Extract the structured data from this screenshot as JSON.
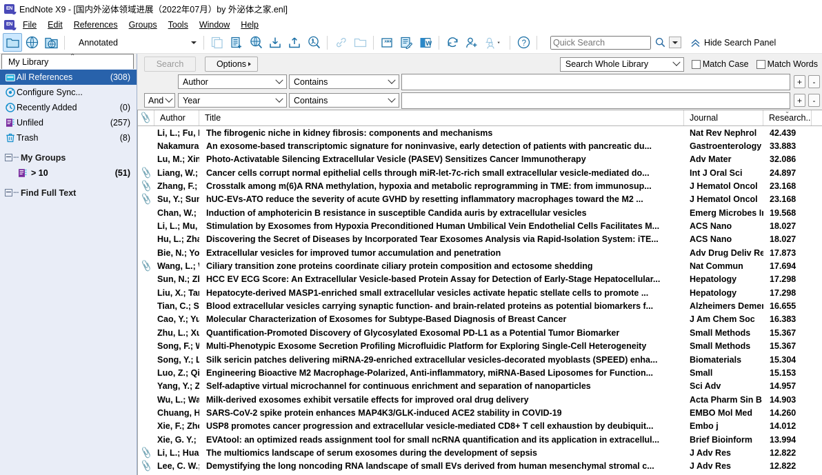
{
  "window": {
    "app_name": "EndNote X9",
    "title": "EndNote X9 - [国内外泌体领域进展（2022年07月）by 外泌体之家.enl]",
    "logo_text": "EN"
  },
  "menubar": {
    "items": [
      {
        "label": "File"
      },
      {
        "label": "Edit"
      },
      {
        "label": "References"
      },
      {
        "label": "Groups"
      },
      {
        "label": "Tools"
      },
      {
        "label": "Window"
      },
      {
        "label": "Help"
      }
    ]
  },
  "toolbar": {
    "style_selected": "Annotated",
    "quick_search_placeholder": "Quick Search",
    "quick_search_value": "",
    "hide_search_panel_label": "Hide Search Panel",
    "icons": [
      "local-library-icon",
      "online-search-icon",
      "integrated-library-icon",
      "copy-references-icon",
      "new-reference-icon",
      "online-search-mode-icon",
      "import-icon",
      "export-icon",
      "open-pdf-icon",
      "link-icon",
      "open-folder-icon",
      "insert-citation-icon",
      "format-bibliography-icon",
      "cwyw-word-icon",
      "sync-icon",
      "share-library-icon",
      "notify-icon",
      "help-icon"
    ]
  },
  "sidebar": {
    "library_tab": "My Library",
    "items": [
      {
        "label": "All References",
        "count": "(308)",
        "icon": "all-references-icon",
        "selected": true
      },
      {
        "label": "Configure Sync...",
        "count": "",
        "icon": "sync-config-icon",
        "selected": false
      },
      {
        "label": "Recently Added",
        "count": "(0)",
        "icon": "recently-added-icon",
        "selected": false
      },
      {
        "label": "Unfiled",
        "count": "(257)",
        "icon": "unfiled-icon",
        "selected": false
      },
      {
        "label": "Trash",
        "count": "(8)",
        "icon": "trash-icon",
        "selected": false
      }
    ],
    "groups": [
      {
        "header": "My Groups",
        "children": [
          {
            "label": "> 10",
            "count": "(51)",
            "icon": "group-icon"
          }
        ]
      },
      {
        "header": "Find Full Text",
        "children": []
      }
    ]
  },
  "search_panel": {
    "search_button": "Search",
    "options_button": "Options",
    "scope_selected": "Search Whole Library",
    "match_case_label": "Match Case",
    "match_words_label": "Match Words",
    "match_case_checked": false,
    "match_words_checked": false,
    "add_row_label": "+",
    "remove_row_label": "-",
    "rows": [
      {
        "operator": "",
        "field": "Author",
        "comparator": "Contains",
        "term": ""
      },
      {
        "operator": "And",
        "field": "Year",
        "comparator": "Contains",
        "term": ""
      }
    ]
  },
  "table": {
    "columns": [
      {
        "key": "clip",
        "label": ""
      },
      {
        "key": "author",
        "label": "Author"
      },
      {
        "key": "title",
        "label": "Title"
      },
      {
        "key": "journal",
        "label": "Journal"
      },
      {
        "key": "rating",
        "label": "Research...",
        "sorted": true,
        "sort_dir": "desc"
      }
    ],
    "rows": [
      {
        "clip": false,
        "author": "Li, L.; Fu, H.; Li...",
        "title": "The fibrogenic niche in kidney fibrosis: components and mechanisms",
        "journal": "Nat Rev Nephrol",
        "rating": "42.439"
      },
      {
        "clip": false,
        "author": "Nakamura, K.;...",
        "title": "An exosome-based transcriptomic signature for noninvasive, early detection of patients with pancreatic du...",
        "journal": "Gastroenterology",
        "rating": "33.883"
      },
      {
        "clip": false,
        "author": "Lu, M.; Xing, H...",
        "title": "Photo-Activatable Silencing Extracellular Vesicle (PASEV) Sensitizes Cancer Immunotherapy",
        "journal": "Adv Mater",
        "rating": "32.086"
      },
      {
        "clip": true,
        "author": "Liang, W.; Che...",
        "title": "Cancer cells corrupt normal epithelial cells through miR-let-7c-rich small extracellular vesicle-mediated do...",
        "journal": "Int J Oral Sci",
        "rating": "24.897"
      },
      {
        "clip": true,
        "author": "Zhang, F.; Liu, ...",
        "title": "Crosstalk among m(6)A RNA methylation, hypoxia and metabolic reprogramming in TME: from immunosup...",
        "journal": "J Hematol Oncol",
        "rating": "23.168"
      },
      {
        "clip": true,
        "author": "Su, Y.; Sun, X.; ...",
        "title": "hUC-EVs-ATO reduce the severity of acute GVHD by resetting inflammatory macrophages toward the M2 ...",
        "journal": "J Hematol Oncol",
        "rating": "23.168"
      },
      {
        "clip": false,
        "author": "Chan, W.; Cho...",
        "title": "Induction of amphotericin B resistance in susceptible Candida auris by extracellular vesicles",
        "journal": "Emerg Microbes Infect",
        "rating": "19.568"
      },
      {
        "clip": false,
        "author": "Li, L.; Mu, J.; Z...",
        "title": "Stimulation by Exosomes from Hypoxia Preconditioned Human Umbilical Vein Endothelial Cells Facilitates M...",
        "journal": "ACS Nano",
        "rating": "18.027"
      },
      {
        "clip": false,
        "author": "Hu, L.; Zhang, ...",
        "title": "Discovering the Secret of Diseases by Incorporated Tear Exosomes Analysis via Rapid-Isolation System: iTE...",
        "journal": "ACS Nano",
        "rating": "18.027"
      },
      {
        "clip": false,
        "author": "Bie, N.; Yong, ...",
        "title": "Extracellular vesicles for improved tumor accumulation and penetration",
        "journal": "Adv Drug Deliv Rev",
        "rating": "17.873"
      },
      {
        "clip": true,
        "author": "Wang, L.; Wen...",
        "title": "Ciliary transition zone proteins coordinate ciliary protein composition and ectosome shedding",
        "journal": "Nat Commun",
        "rating": "17.694"
      },
      {
        "clip": false,
        "author": "Sun, N.; Zhang...",
        "title": "HCC EV ECG Score: An Extracellular Vesicle-based Protein Assay for Detection of Early-Stage Hepatocellular...",
        "journal": "Hepatology",
        "rating": "17.298"
      },
      {
        "clip": false,
        "author": "Liu, X.; Tan, S.;...",
        "title": "Hepatocyte-derived MASP1-enriched small extracellular vesicles activate hepatic stellate cells to promote ...",
        "journal": "Hepatology",
        "rating": "17.298"
      },
      {
        "clip": false,
        "author": "Tian, C.; Stew...",
        "title": "Blood extracellular vesicles carrying synaptic function- and brain-related proteins as potential biomarkers f...",
        "journal": "Alzheimers Dement",
        "rating": "16.655"
      },
      {
        "clip": false,
        "author": "Cao, Y.; Yu, X.; ...",
        "title": "Molecular Characterization of Exosomes for Subtype-Based Diagnosis of Breast Cancer",
        "journal": "J Am Chem Soc",
        "rating": "16.383"
      },
      {
        "clip": false,
        "author": "Zhu, L.; Xu, Y.; ...",
        "title": "Quantification-Promoted Discovery of Glycosylated Exosomal PD-L1 as a Potential Tumor Biomarker",
        "journal": "Small Methods",
        "rating": "15.367"
      },
      {
        "clip": false,
        "author": "Song, F.; Wan...",
        "title": "Multi-Phenotypic Exosome Secretion Profiling Microfluidic Platform for Exploring Single-Cell Heterogeneity",
        "journal": "Small Methods",
        "rating": "15.367"
      },
      {
        "clip": false,
        "author": "Song, Y.; Li, M....",
        "title": "Silk sericin patches delivering miRNA-29-enriched extracellular vesicles-decorated myoblasts (SPEED) enha...",
        "journal": "Biomaterials",
        "rating": "15.304"
      },
      {
        "clip": false,
        "author": "Luo, Z.; Qi, B.; ...",
        "title": "Engineering Bioactive M2 Macrophage-Polarized, Anti-inflammatory, miRNA-Based Liposomes for Function...",
        "journal": "Small",
        "rating": "15.153"
      },
      {
        "clip": false,
        "author": "Yang, Y.; Zhan...",
        "title": "Self-adaptive virtual microchannel for continuous enrichment and separation of nanoparticles",
        "journal": "Sci Adv",
        "rating": "14.957"
      },
      {
        "clip": false,
        "author": "Wu, L.; Wang, ...",
        "title": "Milk-derived exosomes exhibit versatile effects for improved oral drug delivery",
        "journal": "Acta Pharm Sin B",
        "rating": "14.903"
      },
      {
        "clip": false,
        "author": "Chuang, H. C.; ...",
        "title": "SARS-CoV-2 spike protein enhances MAP4K3/GLK-induced ACE2 stability in COVID-19",
        "journal": "EMBO Mol Med",
        "rating": "14.260"
      },
      {
        "clip": false,
        "author": "Xie, F.; Zhou, ...",
        "title": "USP8 promotes cancer progression and extracellular vesicle-mediated CD8+ T cell exhaustion by deubiquit...",
        "journal": "Embo j",
        "rating": "14.012"
      },
      {
        "clip": false,
        "author": "Xie, G. Y.; Liu, ...",
        "title": "EVAtool: an optimized reads assignment tool for small ncRNA quantification and its application in extracellul...",
        "journal": "Brief Bioinform",
        "rating": "13.994"
      },
      {
        "clip": true,
        "author": "Li, L.; Huang, L...",
        "title": "The multiomics landscape of serum exosomes during the development of sepsis",
        "journal": "J Adv Res",
        "rating": "12.822"
      },
      {
        "clip": true,
        "author": "Lee, C. W.; Ch...",
        "title": "Demystifying the long noncoding RNA landscape of small EVs derived from human mesenchymal stromal c...",
        "journal": "J Adv Res",
        "rating": "12.822"
      }
    ]
  },
  "colors": {
    "accent_blue": "#2862ab",
    "icon_blue": "#1a6fa5",
    "sidebar_bg": "#e9edf7",
    "chrome_bg": "#f0f0f0",
    "purple_icon": "#7b2fa0"
  }
}
